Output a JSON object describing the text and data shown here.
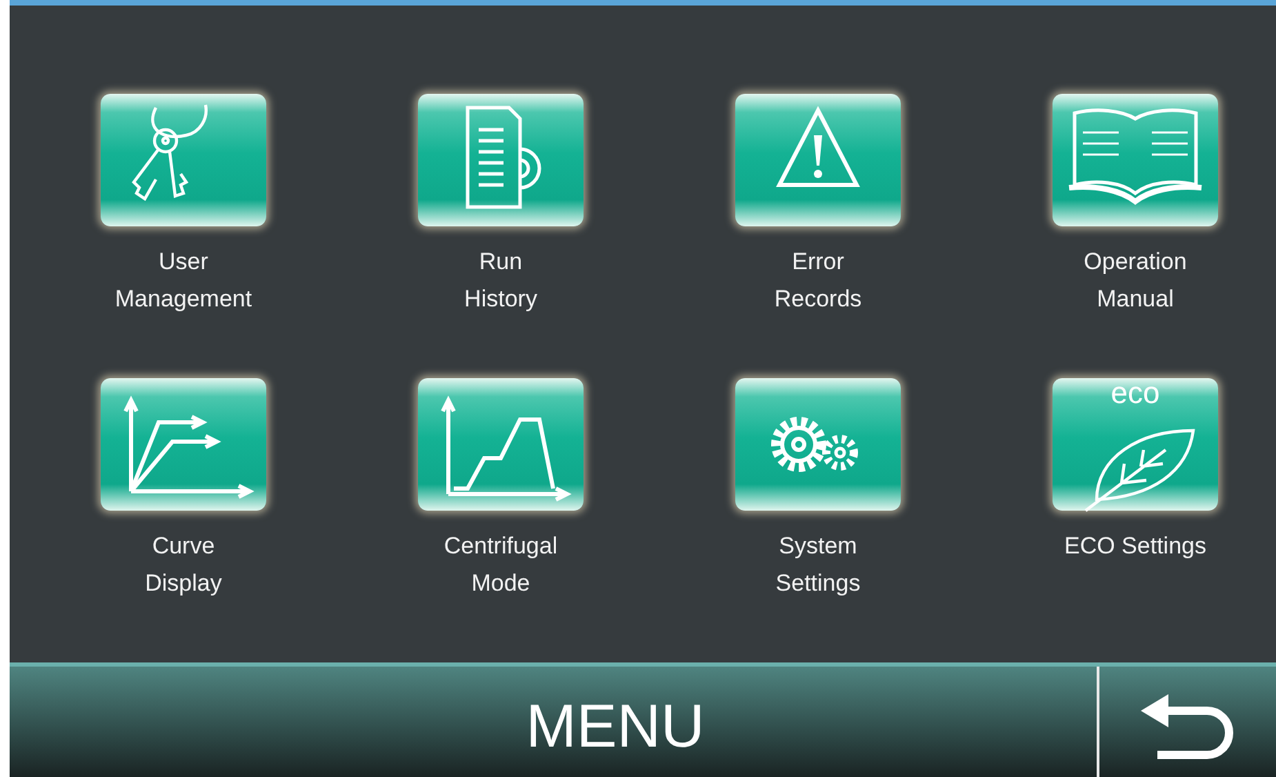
{
  "menu_items": [
    {
      "kind": "keys",
      "label": "User\nManagement"
    },
    {
      "kind": "document",
      "label": "Run\nHistory"
    },
    {
      "kind": "warning",
      "label": "Error\nRecords"
    },
    {
      "kind": "book",
      "label": "Operation\nManual"
    },
    {
      "kind": "curves",
      "label": "Curve\nDisplay"
    },
    {
      "kind": "profile",
      "label": "Centrifugal\nMode"
    },
    {
      "kind": "gears",
      "label": "System\nSettings"
    },
    {
      "kind": "leaf",
      "badge": "eco",
      "label": "ECO Settings"
    }
  ],
  "footer": {
    "title": "MENU"
  }
}
